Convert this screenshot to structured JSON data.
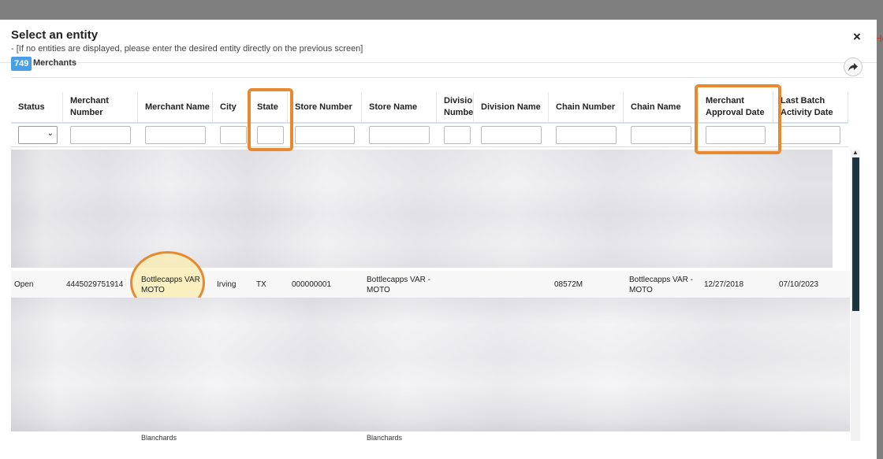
{
  "edge_fragment": "He",
  "modal": {
    "title": "Select an entity",
    "subtitle": "- [If no entities are displayed, please enter the desired entity directly on the previous screen]",
    "close": "×"
  },
  "toolbar": {
    "count": "749",
    "count_label": "Merchants"
  },
  "columns": [
    {
      "label": "Status"
    },
    {
      "label": "Merchant Number"
    },
    {
      "label": "Merchant Name"
    },
    {
      "label": "City"
    },
    {
      "label": "State"
    },
    {
      "label": "Store Number"
    },
    {
      "label": "Store Name"
    },
    {
      "label": "Division Number"
    },
    {
      "label": "Division Name"
    },
    {
      "label": "Chain Number"
    },
    {
      "label": "Chain Name"
    },
    {
      "label": "Merchant Approval Date"
    },
    {
      "label": "Last Batch Activity Date"
    }
  ],
  "row": {
    "status": "Open",
    "merchant_number": "4445029751914",
    "merchant_name": "Bottlecapps VAR MOTO",
    "city": "Irving",
    "state": "TX",
    "store_number": "000000001",
    "store_name": "Bottlecapps VAR - MOTO",
    "division_number": "",
    "division_name": "",
    "chain_number": "08572M",
    "chain_name": "Bottlecapps VAR - MOTO",
    "approval_date": "12/27/2018",
    "last_batch_date": "07/10/2023"
  },
  "next_row_partial": {
    "merchant_name": "Blanchards",
    "store_name": "Blanchards"
  },
  "highlight_color": "#e8892f",
  "badge_color": "#4a9ee6",
  "icons": [
    "close-icon",
    "share-arrow-icon",
    "chevron-down-icon",
    "scroll-up-icon"
  ]
}
